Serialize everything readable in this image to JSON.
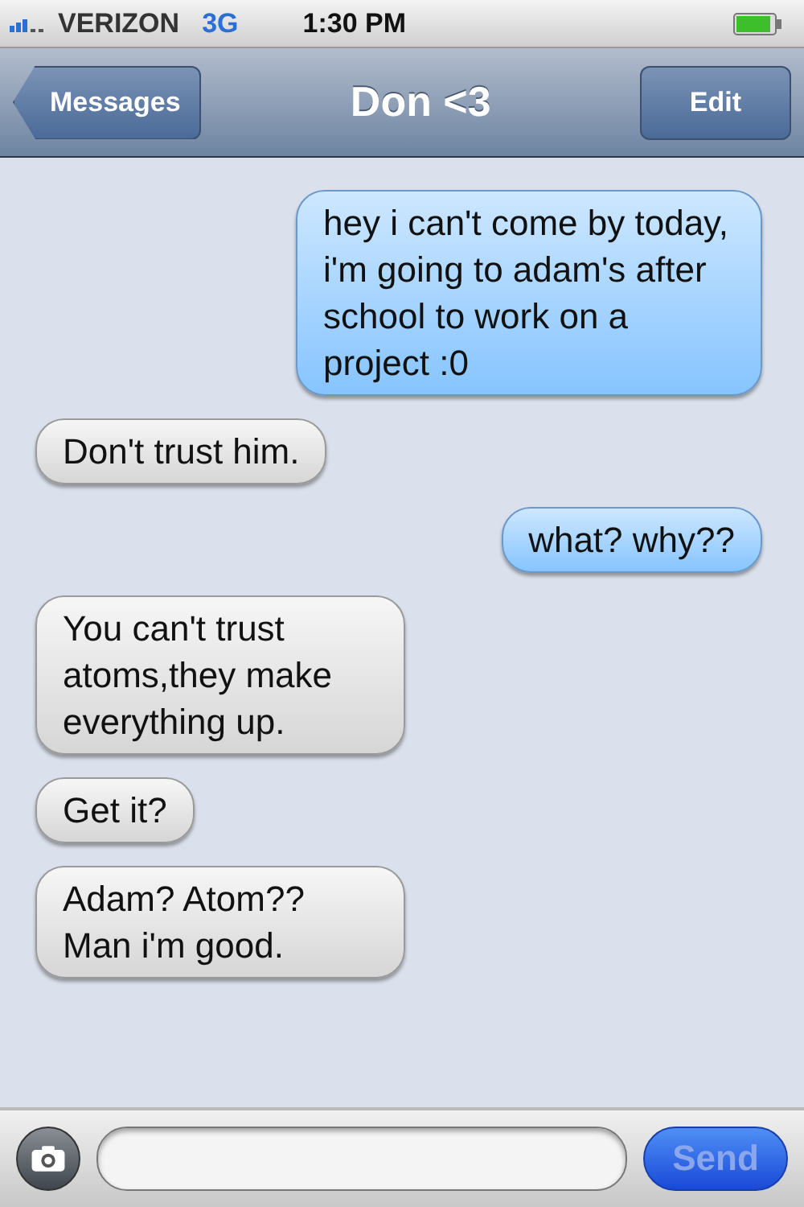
{
  "status_bar": {
    "carrier": "VERIZON",
    "network": "3G",
    "time": "1:30 PM"
  },
  "nav_bar": {
    "back": "Messages",
    "title": "Don <3",
    "action": "Edit"
  },
  "messages": [
    {
      "kind": "sent",
      "text": "hey i can't come by today, i'm going to adam's after school to work on a project :0"
    },
    {
      "kind": "received",
      "text": "Don't trust him."
    },
    {
      "kind": "sent",
      "text": "what? why??"
    },
    {
      "kind": "received",
      "text": "You can't trust atoms,they make everything up."
    },
    {
      "kind": "received",
      "text": "Get it?"
    },
    {
      "kind": "received",
      "text": "Adam? Atom?? Man i'm good."
    }
  ],
  "compose": {
    "send": "Send",
    "send_disabled": true
  }
}
